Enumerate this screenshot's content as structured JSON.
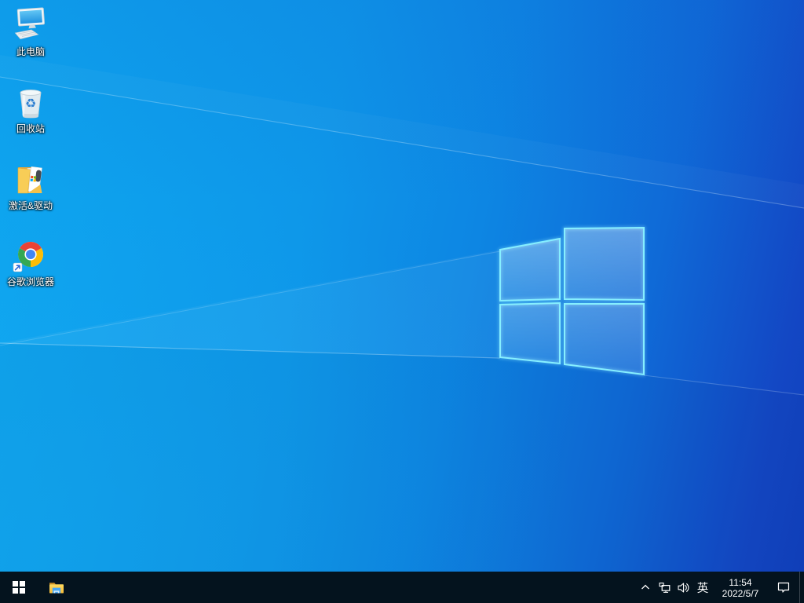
{
  "desktop": {
    "icons": [
      {
        "name": "this-pc",
        "label": "此电脑"
      },
      {
        "name": "recycle-bin",
        "label": "回收站"
      },
      {
        "name": "activation-drivers",
        "label": "激活&驱动"
      },
      {
        "name": "google-chrome",
        "label": "谷歌浏览器"
      }
    ]
  },
  "taskbar": {
    "tray": {
      "icons": [
        "hidden-icons-chevron",
        "network",
        "volume",
        "input-method",
        "clock",
        "action-center",
        "show-desktop"
      ],
      "input_method": "英",
      "time": "11:54",
      "date": "2022/5/7"
    }
  },
  "colors": {
    "taskbar_bg": "#04131e",
    "wallpaper_azure": "#0ea6ef",
    "wallpaper_royal": "#1140bd",
    "logo_edge": "#86efff"
  }
}
